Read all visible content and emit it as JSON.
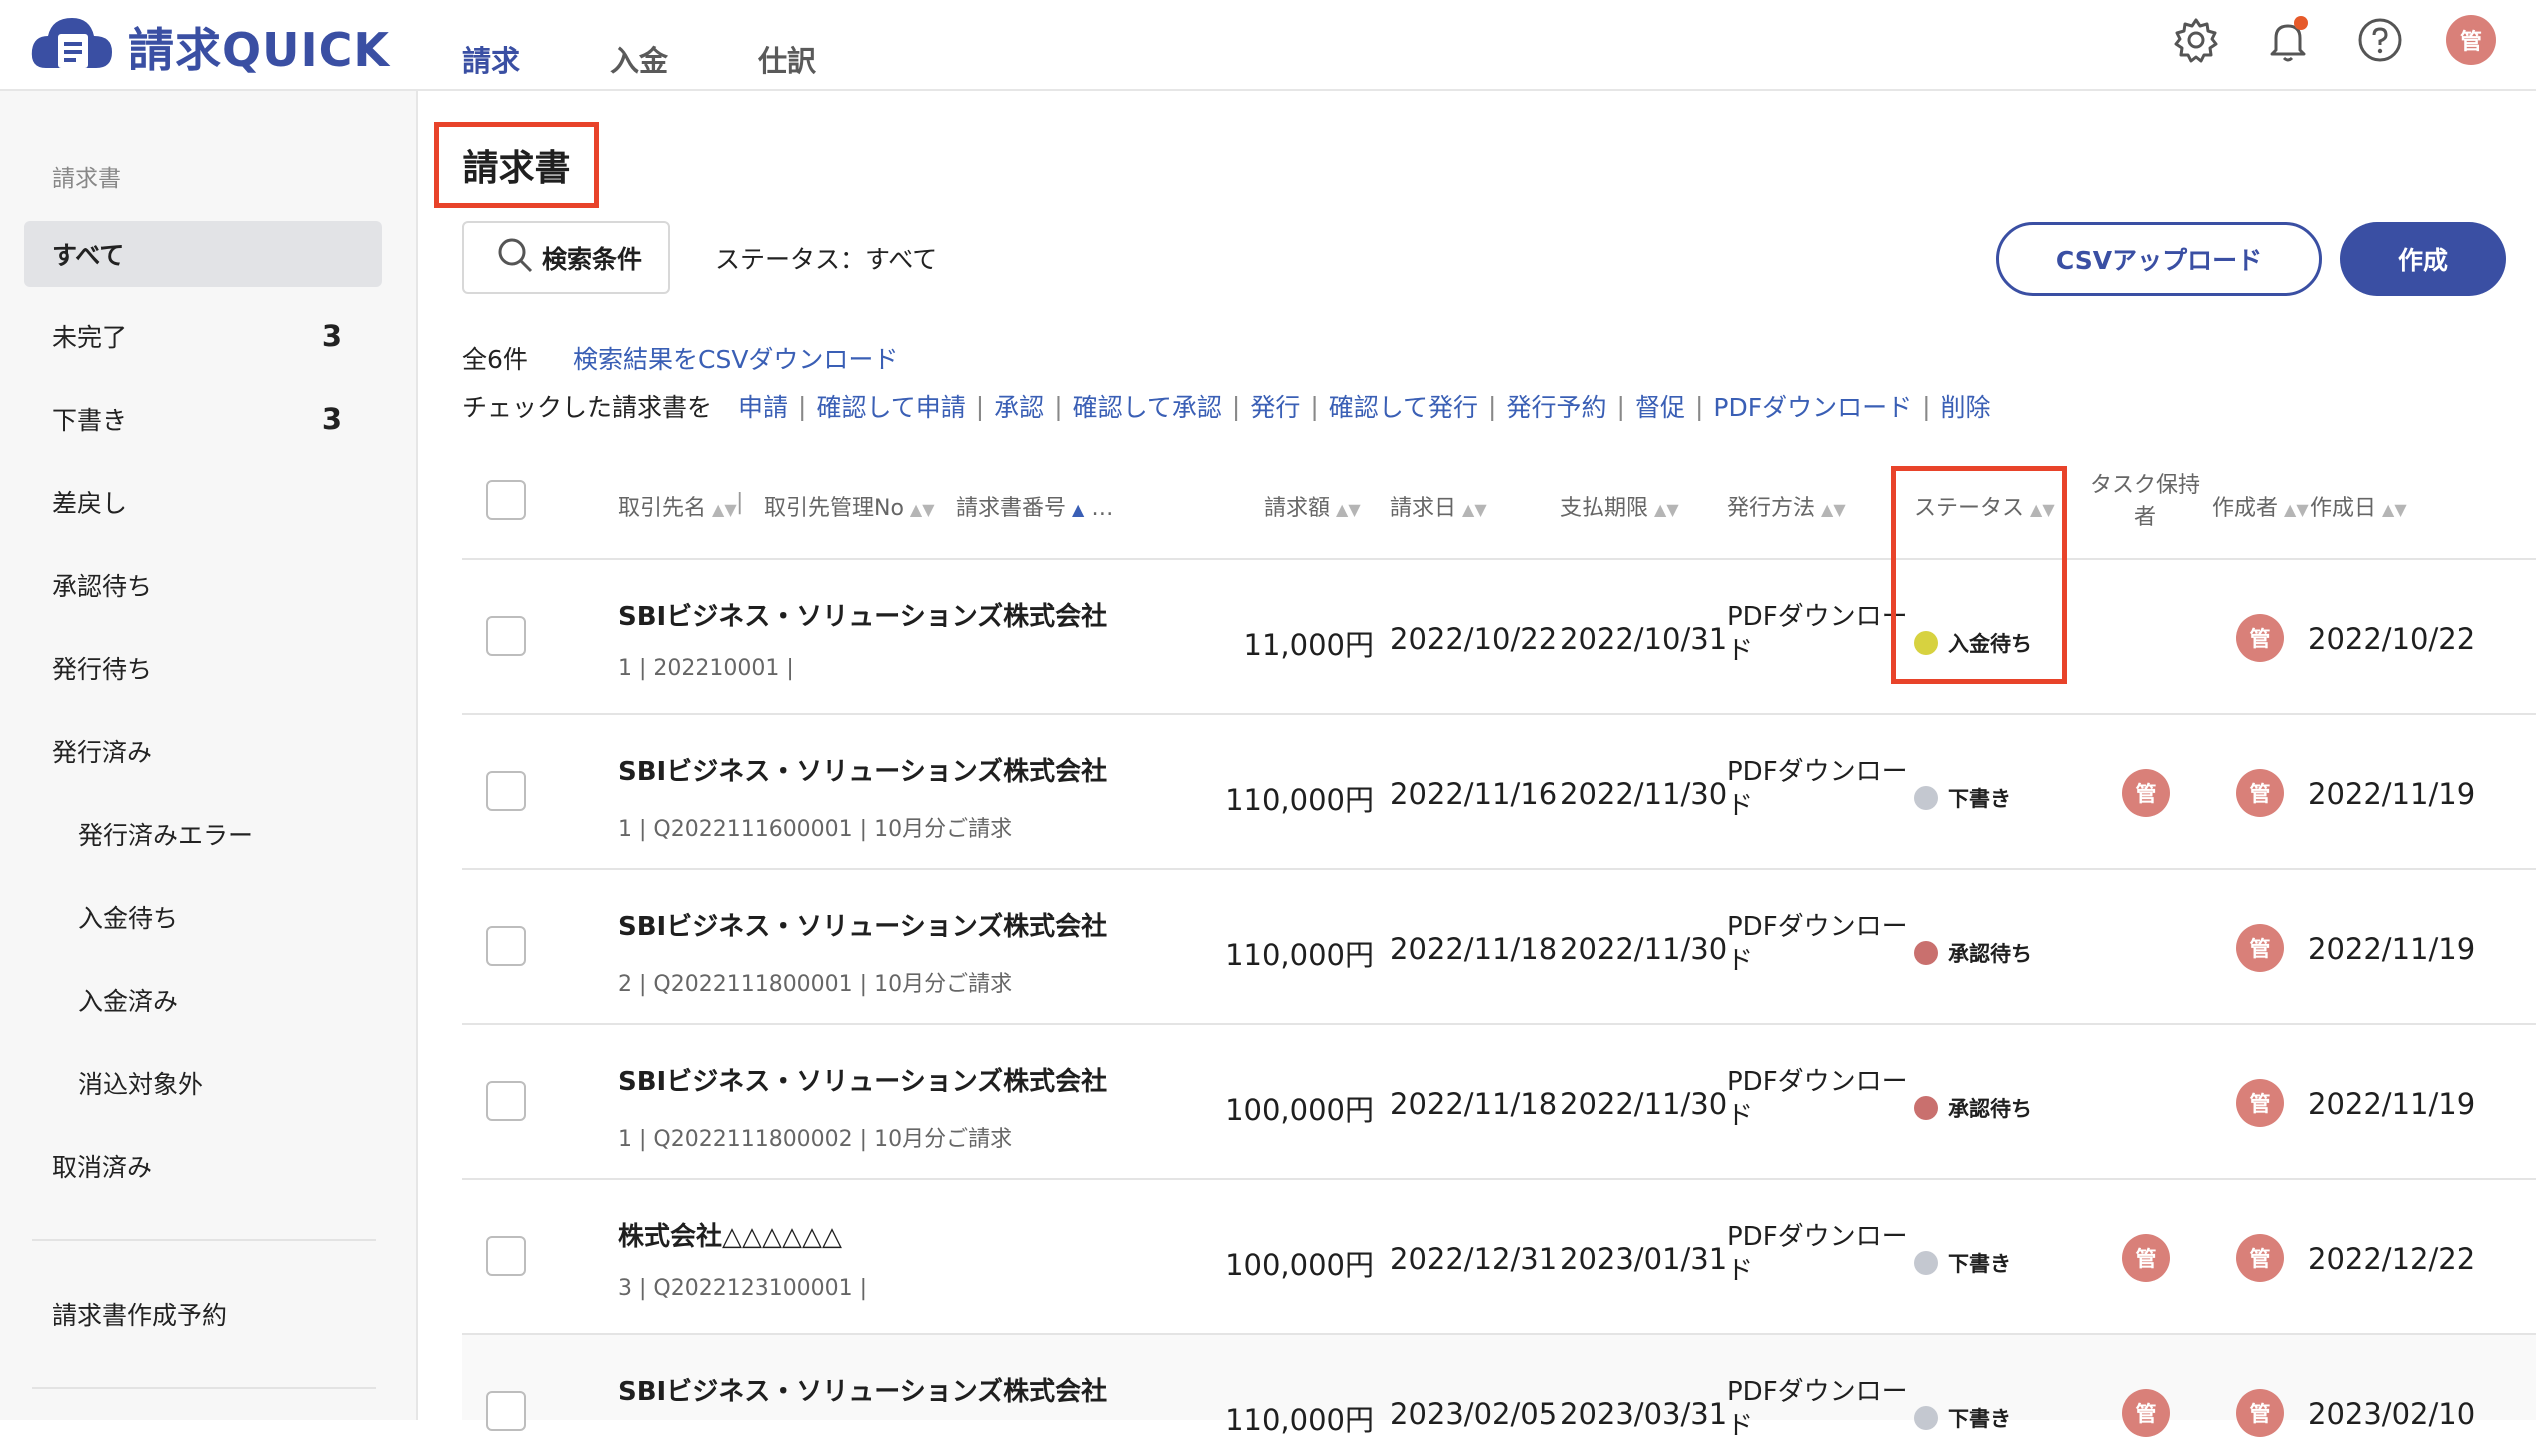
{
  "header": {
    "logo_text": "請求QUICK",
    "tabs": [
      {
        "label": "請求",
        "active": true
      },
      {
        "label": "入金",
        "active": false
      },
      {
        "label": "仕訳",
        "active": false
      }
    ],
    "avatar_label": "管",
    "accent_color": "#3a4fa3"
  },
  "sidebar": {
    "section_title": "請求書",
    "items": [
      {
        "label": "すべて",
        "count": "",
        "active": true
      },
      {
        "label": "未完了",
        "count": "3"
      },
      {
        "label": "下書き",
        "count": "3"
      },
      {
        "label": "差戻し",
        "count": ""
      },
      {
        "label": "承認待ち",
        "count": ""
      },
      {
        "label": "発行待ち",
        "count": ""
      },
      {
        "label": "発行済み",
        "count": ""
      },
      {
        "label": "発行済みエラー",
        "count": "",
        "sub": true
      },
      {
        "label": "入金待ち",
        "count": "",
        "sub": true
      },
      {
        "label": "入金済み",
        "count": "",
        "sub": true
      },
      {
        "label": "消込対象外",
        "count": "",
        "sub": true
      },
      {
        "label": "取消済み",
        "count": ""
      }
    ],
    "reservation": "請求書作成予約"
  },
  "main": {
    "title": "請求書",
    "search_label": "検索条件",
    "status_filter": "ステータス：すべて",
    "csv_upload": "CSVアップロード",
    "create": "作成",
    "total": "全6件",
    "csv_download": "検索結果をCSVダウンロード",
    "bulk_prefix": "チェックした請求書を",
    "bulk_actions": [
      "申請",
      "確認して申請",
      "承認",
      "確認して承認",
      "発行",
      "確認して発行",
      "発行予約",
      "督促",
      "PDFダウンロード",
      "削除"
    ]
  },
  "table": {
    "headers": {
      "client": "取引先名",
      "client_no": "取引先管理No",
      "invoice_no": "請求書番号",
      "more": "…",
      "amount": "請求額",
      "invoice_date": "請求日",
      "due_date": "支払期限",
      "method": "発行方法",
      "status": "ステータス",
      "task_owner_1": "タスク保持",
      "task_owner_2": "者",
      "creator": "作成者",
      "created": "作成日"
    },
    "rows": [
      {
        "client": "SBIビジネス・ソリューションズ株式会社",
        "meta": "1 | 202210001 |",
        "amount": "11,000円",
        "invoice_date": "2022/10/22",
        "due_date": "2022/10/31",
        "method": "PDFダウンロード",
        "status": "入金待ち",
        "status_color": "#d7d240",
        "task_owner": "",
        "creator": "管",
        "created": "2022/10/22"
      },
      {
        "client": "SBIビジネス・ソリューションズ株式会社",
        "meta": "1 | Q2022111600001 | 10月分ご請求",
        "amount": "110,000円",
        "invoice_date": "2022/11/16",
        "due_date": "2022/11/30",
        "method": "PDFダウンロード",
        "status": "下書き",
        "status_color": "#c4c8d0",
        "task_owner": "管",
        "creator": "管",
        "created": "2022/11/19"
      },
      {
        "client": "SBIビジネス・ソリューションズ株式会社",
        "meta": "2 | Q2022111800001 | 10月分ご請求",
        "amount": "110,000円",
        "invoice_date": "2022/11/18",
        "due_date": "2022/11/30",
        "method": "PDFダウンロード",
        "status": "承認待ち",
        "status_color": "#c9706e",
        "task_owner": "",
        "creator": "管",
        "created": "2022/11/19"
      },
      {
        "client": "SBIビジネス・ソリューションズ株式会社",
        "meta": "1 | Q2022111800002 | 10月分ご請求",
        "amount": "100,000円",
        "invoice_date": "2022/11/18",
        "due_date": "2022/11/30",
        "method": "PDFダウンロード",
        "status": "承認待ち",
        "status_color": "#c9706e",
        "task_owner": "",
        "creator": "管",
        "created": "2022/11/19"
      },
      {
        "client": "株式会社△△△△△△",
        "meta": "3 | Q2022123100001 |",
        "amount": "100,000円",
        "invoice_date": "2022/12/31",
        "due_date": "2023/01/31",
        "method": "PDFダウンロード",
        "status": "下書き",
        "status_color": "#c4c8d0",
        "task_owner": "管",
        "creator": "管",
        "created": "2022/12/22"
      },
      {
        "client": "SBIビジネス・ソリューションズ株式会社",
        "meta": "",
        "amount": "110,000円",
        "invoice_date": "2023/02/05",
        "due_date": "2023/03/31",
        "method": "PDFダウンロード",
        "status": "下書き",
        "status_color": "#c4c8d0",
        "task_owner": "管",
        "creator": "管",
        "created": "2023/02/10"
      }
    ]
  }
}
